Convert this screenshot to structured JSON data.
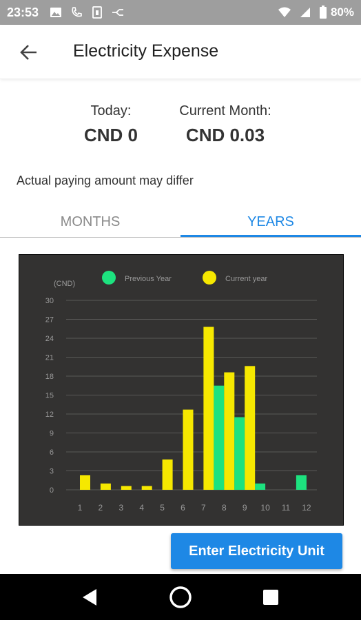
{
  "status_bar": {
    "time": "23:53",
    "battery": "80%",
    "icons": [
      "image-icon",
      "phone-icon",
      "sim-icon",
      "network-icon",
      "wifi-icon",
      "signal-icon",
      "battery-icon"
    ]
  },
  "app_bar": {
    "title": "Electricity Expense"
  },
  "summary": {
    "today_label": "Today:",
    "today_value": "CND 0",
    "month_label": "Current Month:",
    "month_value": "CND 0.03"
  },
  "disclaimer": "Actual paying amount may differ",
  "tabs": [
    {
      "label": "MONTHS",
      "selected": false
    },
    {
      "label": "YEARS",
      "selected": true
    }
  ],
  "chart_data": {
    "type": "bar",
    "ylabel": "(CND)",
    "categories": [
      "1",
      "2",
      "3",
      "4",
      "5",
      "6",
      "7",
      "8",
      "9",
      "10",
      "11",
      "12"
    ],
    "yticks": [
      "0",
      "3",
      "6",
      "9",
      "12",
      "15",
      "18",
      "21",
      "24",
      "27",
      "30"
    ],
    "ylim": [
      0,
      30
    ],
    "grid": true,
    "legend_placement": "top",
    "series": [
      {
        "name": "Previous Year",
        "color": "#1de27f",
        "values": [
          0,
          0,
          0,
          0,
          0,
          0,
          0,
          16.5,
          11.5,
          1,
          0,
          2.3
        ]
      },
      {
        "name": "Current year",
        "color": "#f6e800",
        "values": [
          2.3,
          1,
          0.6,
          0.6,
          4.8,
          12.7,
          25.8,
          18.6,
          19.6,
          0,
          0,
          0
        ]
      }
    ]
  },
  "actions": {
    "enter_unit": "Enter Electricity Unit"
  },
  "colors": {
    "accent": "#1e88e5",
    "chart_bg": "#333231"
  }
}
